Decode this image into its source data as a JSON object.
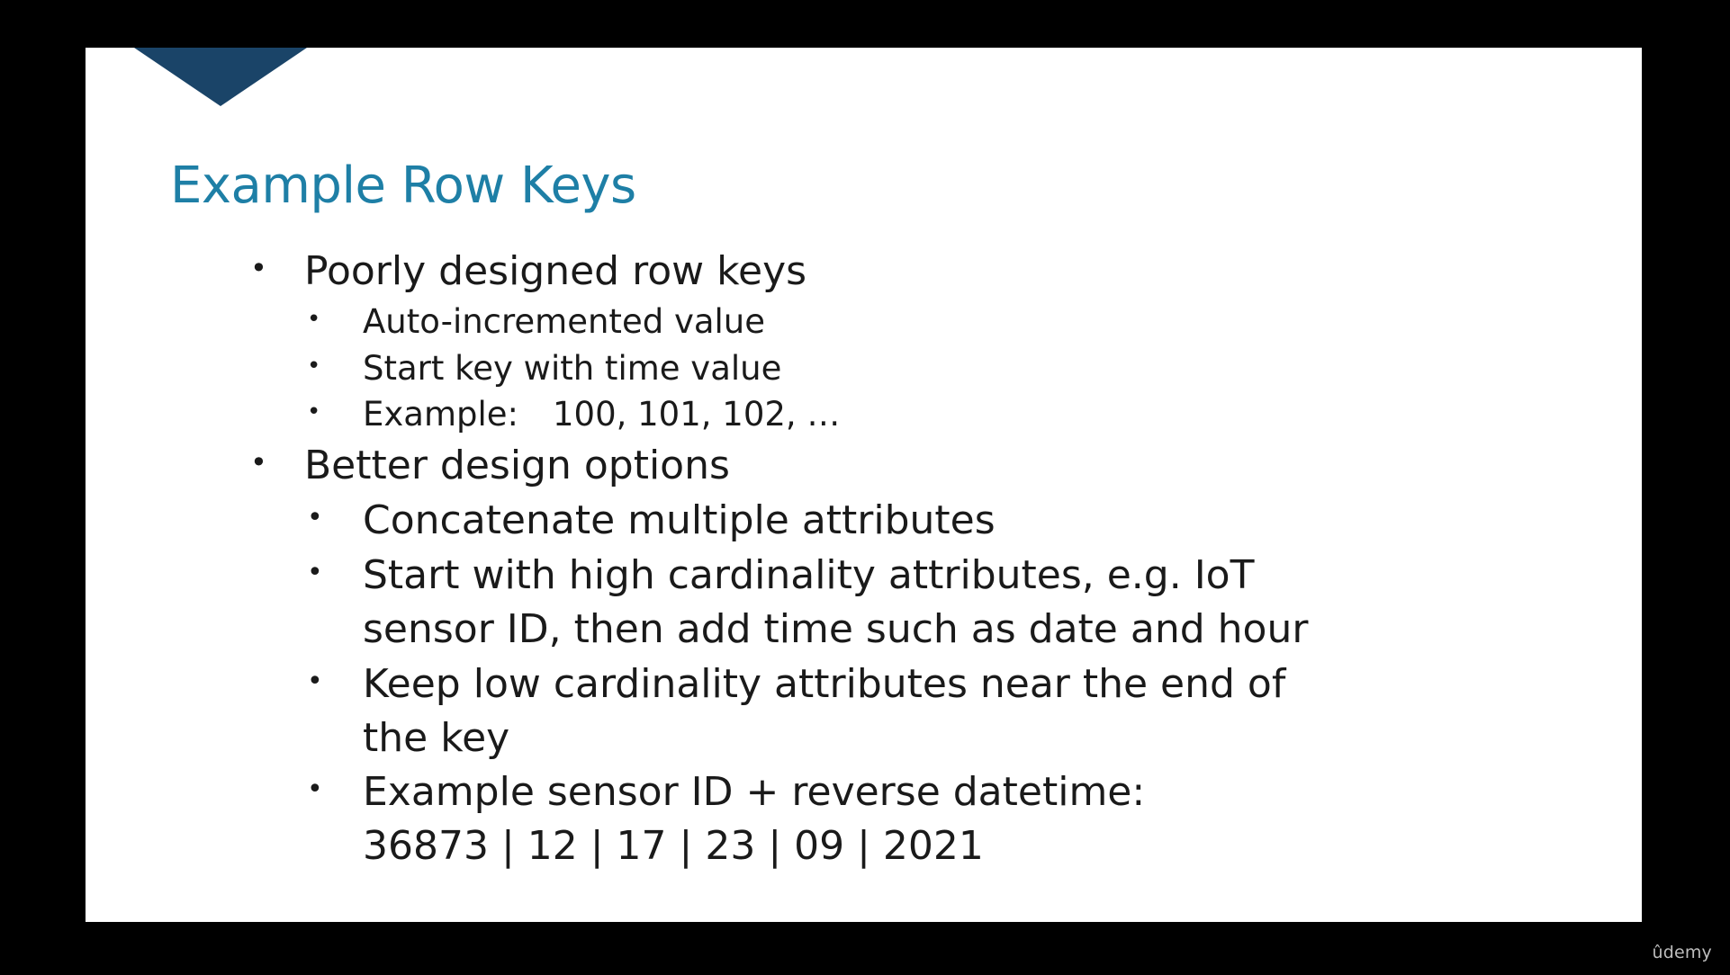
{
  "slide": {
    "title": "Example Row Keys",
    "bullets": [
      {
        "text": "Poorly designed row keys",
        "subbullets": [
          {
            "text": "Auto-incremented value"
          },
          {
            "text": "Start key with time value"
          },
          {
            "text": "Example:",
            "value": "100, 101, 102, …"
          }
        ]
      },
      {
        "text": "Better design options",
        "subbullets": [
          {
            "text": "Concatenate multiple attributes"
          },
          {
            "lines": [
              "Start with high cardinality attributes, e.g. IoT",
              "sensor ID, then add time such as date and hour"
            ]
          },
          {
            "lines": [
              "Keep low cardinality attributes near the end of",
              "the key"
            ]
          },
          {
            "lines": [
              "Example sensor ID + reverse datetime:",
              "36873 | 12 | 17 | 23 | 09 | 2021"
            ]
          }
        ]
      }
    ]
  },
  "watermark": {
    "logo_text": "ûdemy"
  },
  "colors": {
    "background": "#000000",
    "slide": "#ffffff",
    "title": "#1e7fa6",
    "chevron": "#1a4468",
    "text": "#1a1a1a"
  }
}
